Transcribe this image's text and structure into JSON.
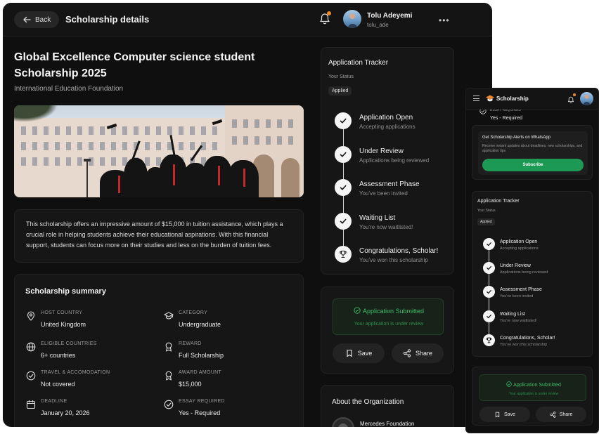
{
  "header": {
    "back_label": "Back",
    "title": "Scholarship details",
    "user_name": "Tolu Adeyemi",
    "user_handle": "tolu_ade",
    "more_glyph": "•••"
  },
  "scholarship": {
    "title": "Global Excellence Computer science student Scholarship 2025",
    "organization": "International Education Foundation",
    "description": "This scholarship offers an impressive amount of $15,000 in tuition assistance, which plays a crucial role in helping students achieve their educational aspirations. With this financial support, students can focus more on their studies and less on the burden of tuition fees."
  },
  "summary": {
    "title": "Scholarship summary",
    "items": [
      {
        "label": "HOST COUNTRY",
        "value": "United Kingdom",
        "icon": "location-pin-icon"
      },
      {
        "label": "CATEGORY",
        "value": "Undergraduate",
        "icon": "graduation-cap-icon"
      },
      {
        "label": "ELIGIBLE COUNTRIES",
        "value": "6+ countries",
        "icon": "globe-icon"
      },
      {
        "label": "REWARD",
        "value": "Full Scholarship",
        "icon": "award-icon"
      },
      {
        "label": "TRAVEL & ACCOMODATION",
        "value": "Not covered",
        "icon": "check-circle-icon"
      },
      {
        "label": "AWARD AMOUNT",
        "value": "$15,000",
        "icon": "award-icon"
      },
      {
        "label": "DEADLINE",
        "value": "January 20, 2026",
        "icon": "calendar-icon"
      },
      {
        "label": "ESSAY REQUIRED",
        "value": "Yes - Required",
        "icon": "check-circle-icon"
      }
    ]
  },
  "tracker": {
    "title": "Application Tracker",
    "status_label": "Your Status",
    "status_value": "Applied",
    "steps": [
      {
        "name": "Application Open",
        "sub": "Accepting applications",
        "icon": "check-icon"
      },
      {
        "name": "Under Review",
        "sub": "Applications being reviewed",
        "icon": "check-icon"
      },
      {
        "name": "Assessment Phase",
        "sub": "You've been invited",
        "icon": "check-icon"
      },
      {
        "name": "Waiting List",
        "sub": "You're now waitlisted!",
        "icon": "check-icon"
      },
      {
        "name": "Congratulations, Scholar!",
        "sub": "You've won this scholarship",
        "icon": "trophy-icon"
      }
    ]
  },
  "submission": {
    "title": "Application Submitted",
    "note": "Your application is under review",
    "save_label": "Save",
    "share_label": "Share"
  },
  "about": {
    "title": "About the Organization",
    "org_name": "Mercedes Foundation"
  },
  "mobile": {
    "brand": "Scholarship",
    "essay_label": "ESSAY REQUIRED",
    "essay_value": "Yes - Required",
    "whatsapp": {
      "title": "Get Scholarship Alerts on WhatsApp",
      "text": "Receive instant updates about deadlines, new scholarships, and application tips",
      "button": "Subscribe"
    }
  },
  "colors": {
    "background": "#0f0f0f",
    "card": "#161616",
    "success_green": "#3fbe6a",
    "whatsapp_green": "#1c9a55",
    "notification_orange": "#f0892c"
  }
}
